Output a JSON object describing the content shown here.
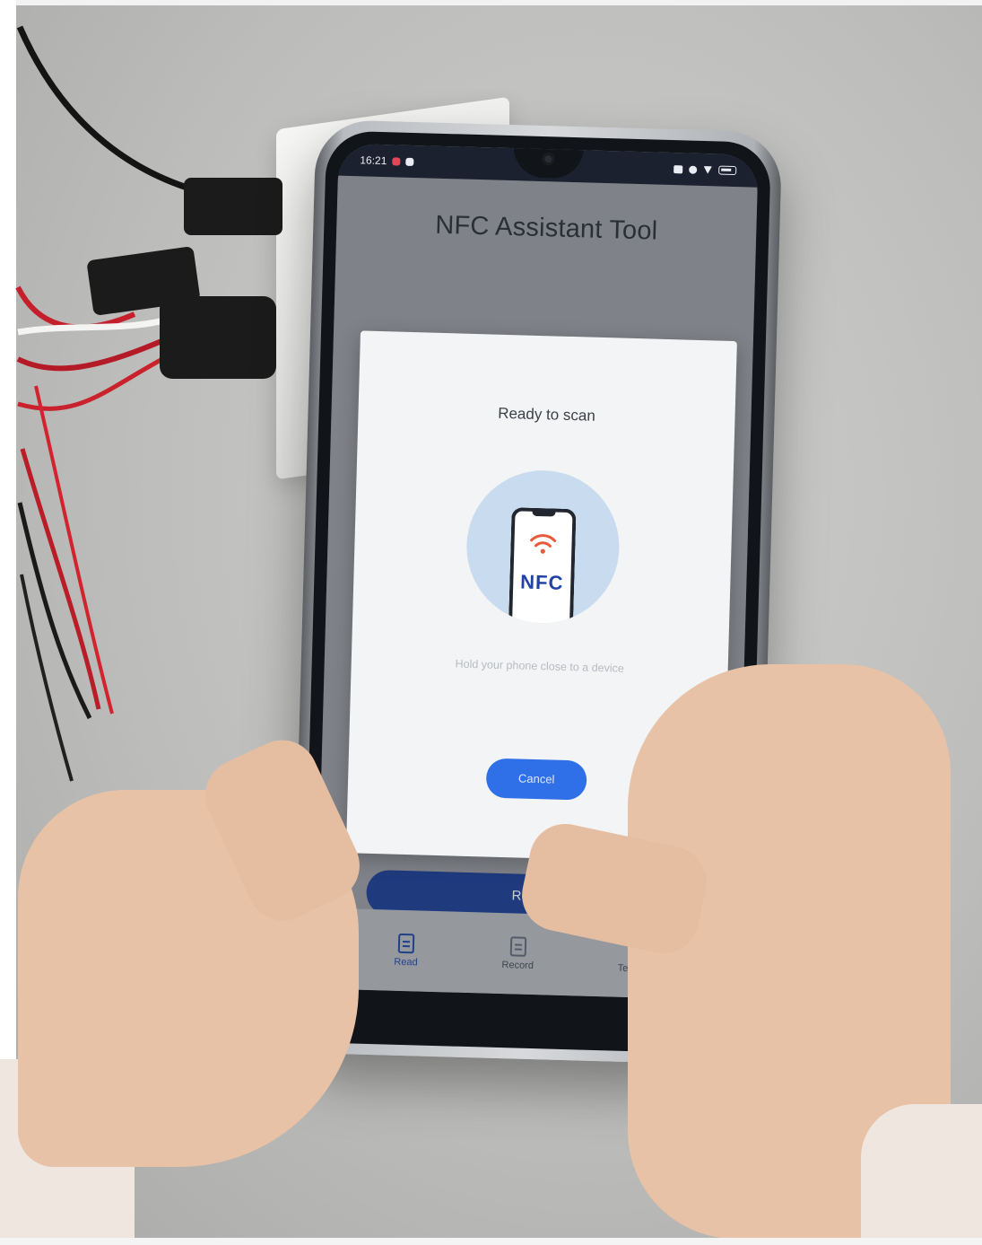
{
  "app": {
    "title": "NFC Assistant Tool",
    "status_time": "16:21"
  },
  "dialog": {
    "title": "Ready to scan",
    "illustration_label": "NFC",
    "hint": "Hold your phone close to a device",
    "cancel_label": "Cancel"
  },
  "main": {
    "read_button_label": "Read"
  },
  "bottom_nav": {
    "items": [
      {
        "label": "Read",
        "icon": "read-icon",
        "active": true
      },
      {
        "label": "Record",
        "icon": "record-icon",
        "active": false
      },
      {
        "label": "Template",
        "icon": "template-icon",
        "active": false
      }
    ]
  },
  "colors": {
    "primary_blue": "#2f6fe8",
    "dark_blue": "#193a8a",
    "nfc_text": "#1f43a6",
    "wave_red": "#e85a3a",
    "dialog_bg": "#f3f4f5"
  }
}
